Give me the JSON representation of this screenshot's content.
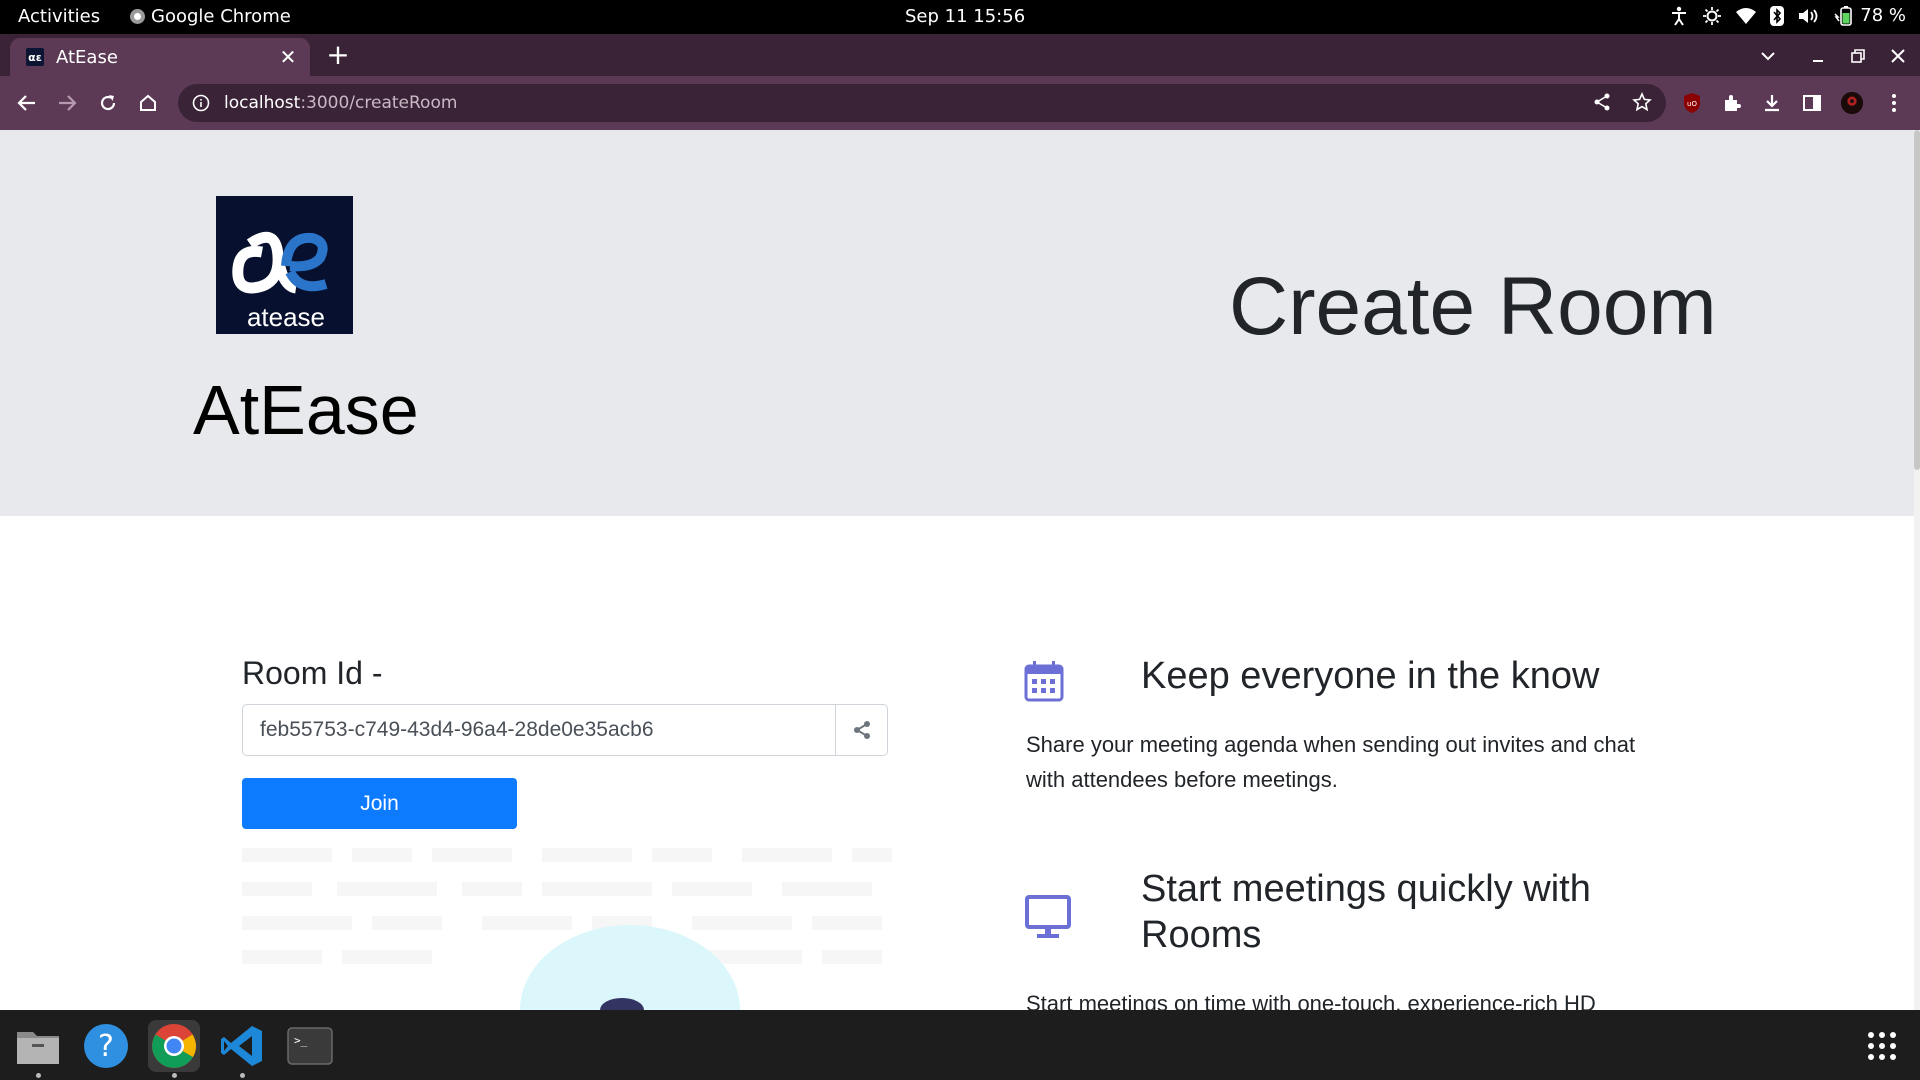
{
  "topbar": {
    "activities": "Activities",
    "app_name": "Google Chrome",
    "clock": "Sep 11  15:56",
    "battery": "78 %"
  },
  "browser": {
    "tab_title": "AtEase",
    "favicon_text": "αε",
    "url_host": "localhost",
    "url_path": ":3000/createRoom",
    "colors": {
      "frame": "#3a2336",
      "toolbar": "#5c3a55"
    }
  },
  "hero": {
    "logo_text": "atease",
    "brand": "AtEase",
    "title": "Create Room"
  },
  "room": {
    "label": "Room Id -",
    "room_id": "feb55753-c749-43d4-96a4-28de0e35acb6",
    "join_label": "Join"
  },
  "features": [
    {
      "icon": "calendar-icon",
      "title": "Keep everyone in the know",
      "text": "Share your meeting agenda when sending out invites and chat with attendees before meetings."
    },
    {
      "icon": "monitor-icon",
      "title_line1": "Start meetings quickly with",
      "title_line2": "Rooms",
      "text": "Start meetings on time with one-touch, experience-rich HD"
    }
  ],
  "colors": {
    "hero_bg": "#e8e9ec",
    "primary_button": "#0d7bff",
    "feature_icon": "#6b6fd6"
  },
  "dock": {
    "items": [
      "files-icon",
      "help-icon",
      "chrome-icon",
      "vscode-icon",
      "terminal-icon"
    ],
    "terminal_prompt": ">_"
  }
}
